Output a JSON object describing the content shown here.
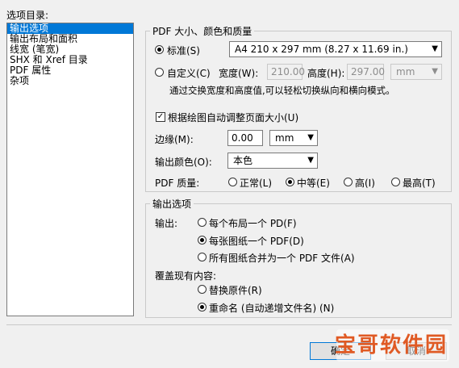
{
  "dialog": {
    "options_directory_label": "选项目录:",
    "options_list": [
      "输出选项",
      "输出布局和面积",
      "线宽 (笔宽)",
      "SHX 和 Xref 目录",
      "PDF 属性",
      "杂项"
    ],
    "selected_index": 0
  },
  "pdf_group": {
    "title": "PDF 大小、颜色和质量",
    "standard_label": "标准(S)",
    "standard_value": "A4 210 x 297 mm (8.27 x 11.69 in.)",
    "custom_label": "自定义(C)",
    "width_label": "宽度(W):",
    "width_value": "210.00",
    "height_label": "高度(H):",
    "height_value": "297.00",
    "unit_disabled": "mm",
    "hint": "通过交换宽度和高度值,可以轻松切换纵向和横向模式。",
    "auto_adjust_label": "根据绘图自动调整页面大小(U)",
    "margin_label": "边缘(M):",
    "margin_value": "0.00",
    "margin_unit": "mm",
    "color_label": "输出颜色(O):",
    "color_value": "本色",
    "quality_label": "PDF 质量:",
    "quality_options": [
      "正常(L)",
      "中等(E)",
      "高(I)",
      "最高(T)"
    ],
    "quality_selected": 1
  },
  "output_group": {
    "title": "输出选项",
    "output_label": "输出:",
    "output_options": [
      "每个布局一个 PD(F)",
      "每张图纸一个 PDF(D)",
      "所有图纸合并为一个 PDF 文件(A)"
    ],
    "output_selected": 1,
    "overwrite_label": "覆盖现有内容:",
    "overwrite_options": [
      "替换原件(R)",
      "重命名 (自动递增文件名) (N)"
    ],
    "overwrite_selected": 1
  },
  "buttons": {
    "ok": "确定",
    "cancel": "取消"
  },
  "watermark": "宝哥软件园",
  "icons": {
    "combo_arrow": "chevron-down-icon",
    "check": "checkmark-icon"
  }
}
